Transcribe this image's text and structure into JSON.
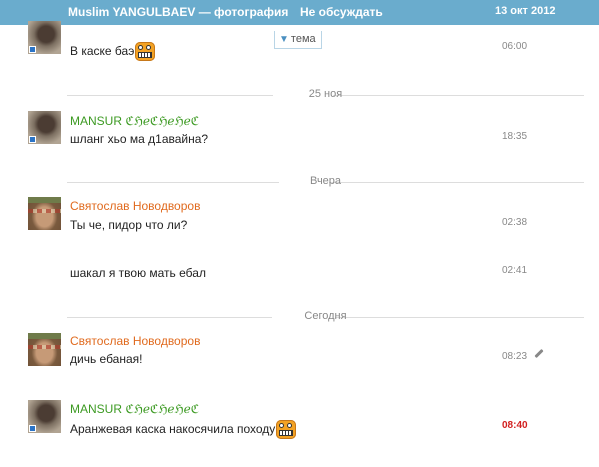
{
  "header": {
    "title": "Muslim YANGULBAEV — фотография",
    "no_discuss": "Не обсуждать",
    "date": "13 окт 2012"
  },
  "tema_button": {
    "arrow": "▼",
    "label": "тема"
  },
  "days": [
    "25 ноя",
    "Вчера",
    "Сегодня"
  ],
  "messages": [
    {
      "author": "",
      "text": "В каске баэ",
      "time": "06:00",
      "emoji": "grinning-smiley-icon"
    },
    {
      "author": "MANSUR ℭℌℯℭℌℯℌℯℭ",
      "text": "шланг хьо ма д1авайна?",
      "time": "18:35"
    },
    {
      "author": "Святослав Новодворов",
      "text": "Ты че, пидор что ли?",
      "time": "02:38"
    },
    {
      "author": "",
      "text": "шакал я твою мать ебал",
      "time": "02:41"
    },
    {
      "author": "Святослав Новодворов",
      "text": "дичь ебаная!",
      "time": "08:23",
      "edited_icon": "pencil-icon"
    },
    {
      "author": "MANSUR ℭℌℯℭℌℯℌℯℭ",
      "text": "Аранжевая каска накосячила походу",
      "time": "08:40",
      "emoji": "grinning-smiley-icon"
    }
  ],
  "colors": {
    "topbar": "#6aaccd",
    "author_green": "#3c9a22",
    "author_orange": "#e06a1e",
    "time_unread": "#d21f1f"
  }
}
